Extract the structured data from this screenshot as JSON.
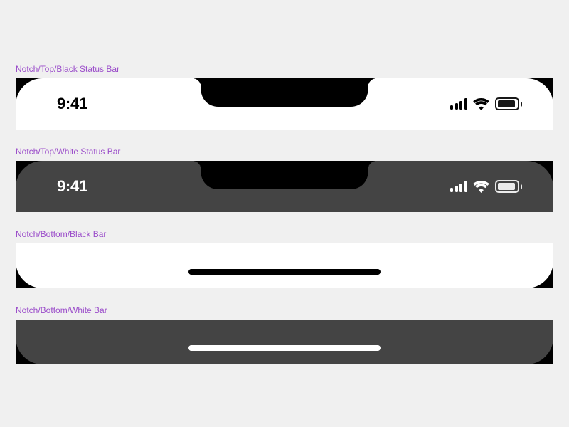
{
  "variants": {
    "top_black": {
      "label": "Notch/Top/Black Status Bar",
      "time": "9:41",
      "battery_pct": 95
    },
    "top_white": {
      "label": "Notch/Top/White Status Bar",
      "time": "9:41",
      "battery_pct": 95
    },
    "bottom_black": {
      "label": "Notch/Bottom/Black Bar"
    },
    "bottom_white": {
      "label": "Notch/Bottom/White Bar"
    }
  },
  "colors": {
    "label": "#9b4dca",
    "frame_bg": "#000000",
    "dark_surface": "#444444",
    "light_surface": "#ffffff",
    "page_bg": "#f0f0f0"
  }
}
